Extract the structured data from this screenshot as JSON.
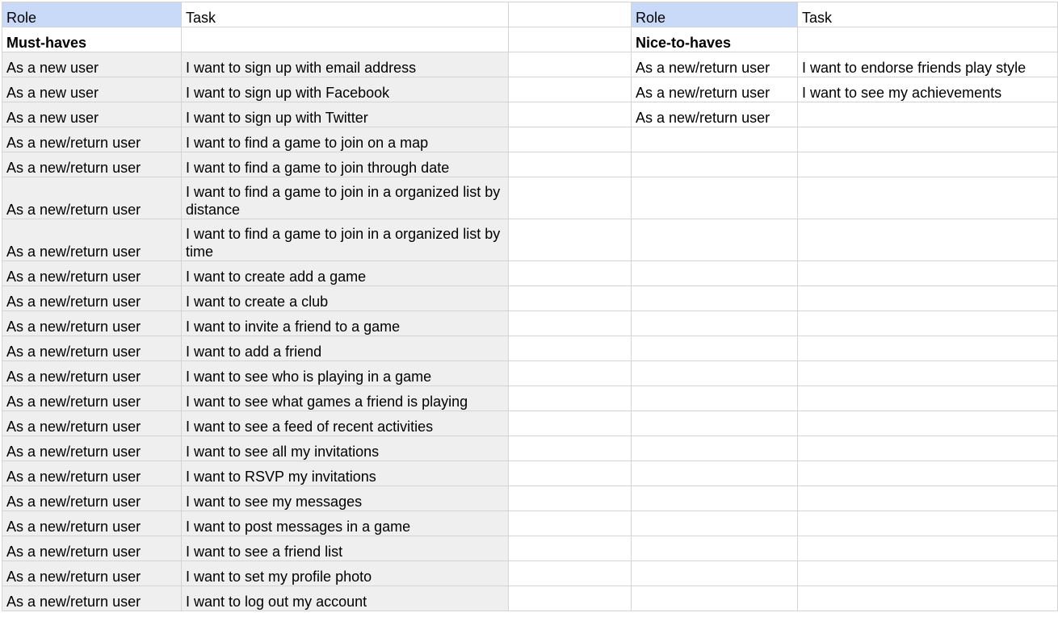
{
  "colors": {
    "header_fill": "#c9daf8",
    "cell_fill_gray": "#efefef",
    "gridline": "#d4d4d4"
  },
  "headers": {
    "left_role": "Role",
    "left_task": "Task",
    "right_role": "Role",
    "right_task": "Task"
  },
  "sections": {
    "left": "Must-haves",
    "right": "Nice-to-haves"
  },
  "must_haves": [
    {
      "role": "As a new user",
      "task": "I want to sign up with email address"
    },
    {
      "role": "As a new user",
      "task": "I want to sign up with Facebook"
    },
    {
      "role": "As a new user",
      "task": "I want to sign up with Twitter"
    },
    {
      "role": "As a new/return user",
      "task": "I want to find a game to join on a map"
    },
    {
      "role": "As a new/return user",
      "task": "I want to find a game to join through date"
    },
    {
      "role": "As a new/return user",
      "task": "I want to find a game to join in a organized list by distance"
    },
    {
      "role": "As a new/return user",
      "task": "I want to find a game to join in a organized list by time"
    },
    {
      "role": "As a new/return user",
      "task": "I want to create add a game"
    },
    {
      "role": "As a new/return user",
      "task": "I want to create a club"
    },
    {
      "role": "As a new/return user",
      "task": "I want to invite a friend to a game"
    },
    {
      "role": "As a new/return user",
      "task": "I want to add a friend"
    },
    {
      "role": "As a new/return user",
      "task": "I want to see who is playing in a game"
    },
    {
      "role": "As a new/return user",
      "task": "I want to see what games a friend is playing"
    },
    {
      "role": "As a new/return user",
      "task": "I want to see a feed of recent activities"
    },
    {
      "role": "As a new/return user",
      "task": "I want to see all my invitations"
    },
    {
      "role": "As a new/return user",
      "task": "I want to RSVP my invitations"
    },
    {
      "role": "As a new/return user",
      "task": "I want to see my messages"
    },
    {
      "role": "As a new/return user",
      "task": "I want to post messages in a game"
    },
    {
      "role": "As a new/return user",
      "task": "I want to see a friend list"
    },
    {
      "role": "As a new/return user",
      "task": "I want to set my profile photo"
    },
    {
      "role": "As a new/return user",
      "task": "I want to log out my account"
    }
  ],
  "nice_to_haves": [
    {
      "role": "As a new/return user",
      "task": "I want to endorse friends play style"
    },
    {
      "role": "As a new/return user",
      "task": "I want to see my achievements"
    },
    {
      "role": "As a new/return user",
      "task": ""
    }
  ]
}
